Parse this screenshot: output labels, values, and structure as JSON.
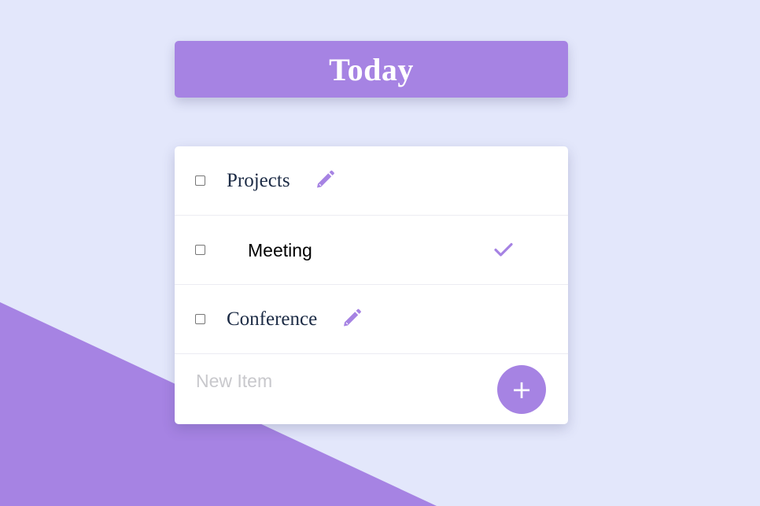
{
  "header": {
    "title": "Today"
  },
  "todo": {
    "items": [
      {
        "label": "Projects",
        "checked": false,
        "mode": "view",
        "action_icon": "pencil-icon"
      },
      {
        "label": "Meeting",
        "checked": false,
        "mode": "edit",
        "action_icon": "check-icon"
      },
      {
        "label": "Conference",
        "checked": false,
        "mode": "view",
        "action_icon": "pencil-icon"
      }
    ],
    "new_item": {
      "placeholder": "New Item",
      "value": ""
    },
    "add_button": {
      "label": "+",
      "icon": "plus-icon"
    }
  },
  "colors": {
    "background": "#e3e7fb",
    "accent": "#a683e3",
    "card": "#ffffff",
    "item_text": "#1c2b45"
  }
}
